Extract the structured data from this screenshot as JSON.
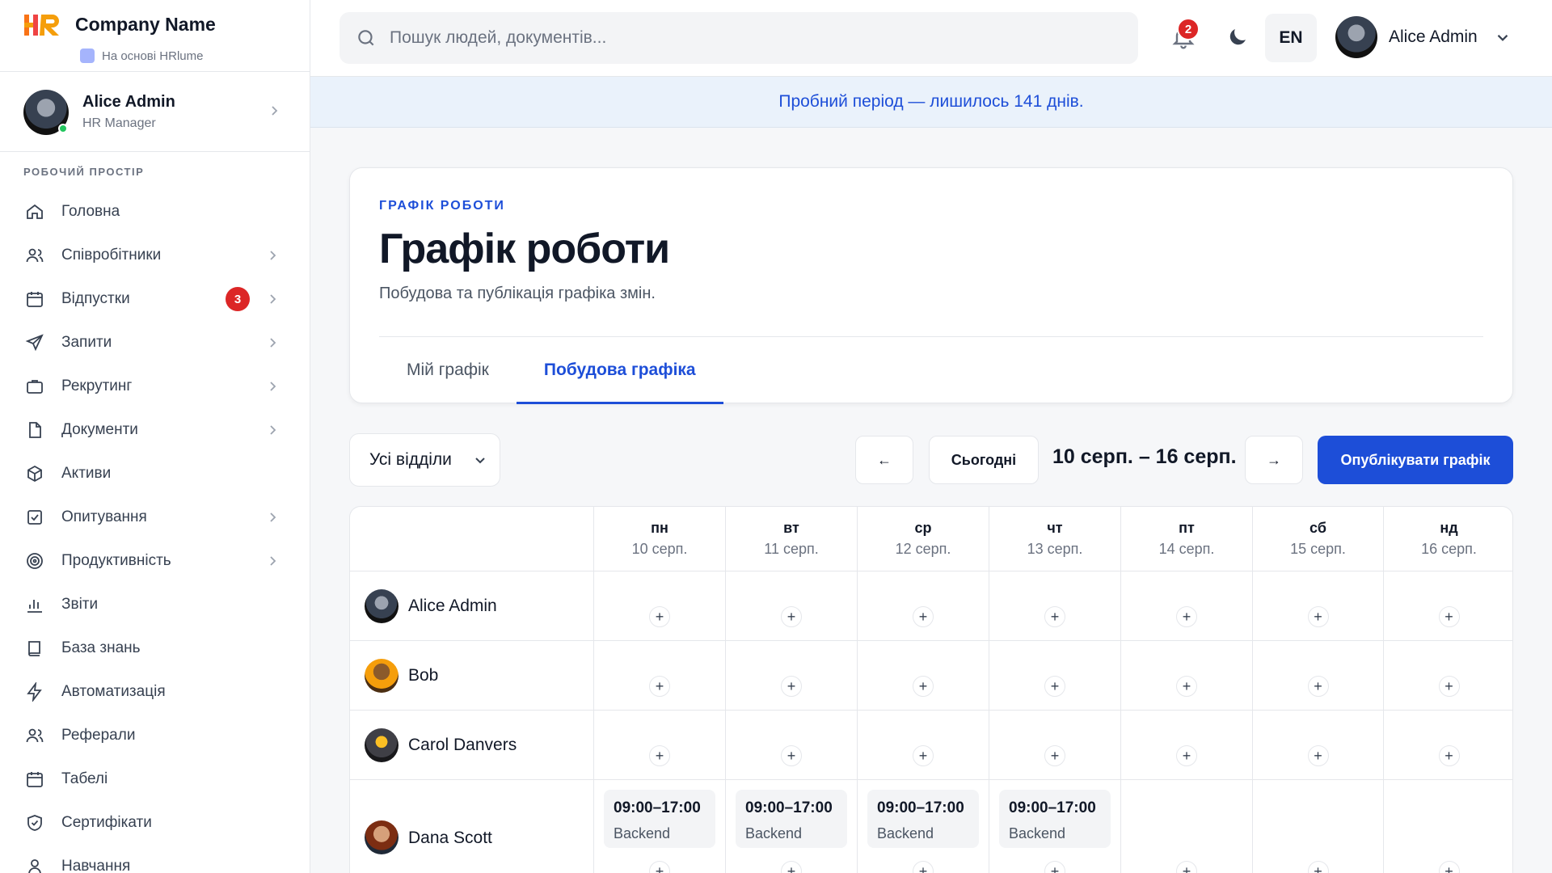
{
  "brand": {
    "name": "Company Name",
    "subtitle": "На основі HRlume"
  },
  "user_card": {
    "name": "Alice Admin",
    "role": "HR Manager"
  },
  "sidebar": {
    "section_label": "РОБОЧИЙ ПРОСТІР",
    "items": [
      {
        "label": "Головна",
        "icon": "home-icon"
      },
      {
        "label": "Співробітники",
        "icon": "users-icon"
      },
      {
        "label": "Відпустки",
        "icon": "calendar-icon",
        "badge": "3"
      },
      {
        "label": "Запити",
        "icon": "send-icon"
      },
      {
        "label": "Рекрутинг",
        "icon": "briefcase-icon"
      },
      {
        "label": "Документи",
        "icon": "document-icon"
      },
      {
        "label": "Активи",
        "icon": "box-icon"
      },
      {
        "label": "Опитування",
        "icon": "checkbox-icon"
      },
      {
        "label": "Продуктивність",
        "icon": "target-icon"
      },
      {
        "label": "Звіти",
        "icon": "bar-chart-icon"
      },
      {
        "label": "База знань",
        "icon": "book-icon"
      },
      {
        "label": "Автоматизація",
        "icon": "lightning-icon"
      },
      {
        "label": "Реферали",
        "icon": "users-icon"
      },
      {
        "label": "Табелі",
        "icon": "calendar-icon"
      },
      {
        "label": "Сертифікати",
        "icon": "shield-check-icon"
      },
      {
        "label": "Навчання",
        "icon": "user-icon"
      }
    ]
  },
  "topbar": {
    "search_placeholder": "Пошук людей, документів...",
    "notifications_count": "2",
    "language": "EN",
    "user_name": "Alice Admin"
  },
  "trial_banner": "Пробний період — лишилось 141 днів.",
  "page": {
    "eyebrow": "ГРАФІК РОБОТИ",
    "title": "Графік роботи",
    "subtitle": "Побудова та публікація графіка змін.",
    "tabs": [
      "Мій графік",
      "Побудова графіка"
    ],
    "active_tab": "Побудова графіка"
  },
  "toolbar": {
    "department": "Усі відділи",
    "prev": "←",
    "today": "Сьогодні",
    "week_range": "10 серп. – 16 серп.",
    "next": "→",
    "publish": "Опублікувати графік"
  },
  "schedule": {
    "days": [
      {
        "dow": "пн",
        "date": "10 серп."
      },
      {
        "dow": "вт",
        "date": "11 серп."
      },
      {
        "dow": "ср",
        "date": "12 серп."
      },
      {
        "dow": "чт",
        "date": "13 серп."
      },
      {
        "dow": "пт",
        "date": "14 серп."
      },
      {
        "dow": "сб",
        "date": "15 серп."
      },
      {
        "dow": "нд",
        "date": "16 серп."
      }
    ],
    "add_symbol": "+",
    "employees": [
      {
        "name": "Alice Admin",
        "shifts": [
          null,
          null,
          null,
          null,
          null,
          null,
          null
        ]
      },
      {
        "name": "Bob",
        "shifts": [
          null,
          null,
          null,
          null,
          null,
          null,
          null
        ]
      },
      {
        "name": "Carol Danvers",
        "shifts": [
          null,
          null,
          null,
          null,
          null,
          null,
          null
        ]
      },
      {
        "name": "Dana Scott",
        "shifts": [
          {
            "time": "09:00–17:00",
            "team": "Backend"
          },
          {
            "time": "09:00–17:00",
            "team": "Backend"
          },
          {
            "time": "09:00–17:00",
            "team": "Backend"
          },
          {
            "time": "09:00–17:00",
            "team": "Backend"
          },
          null,
          null,
          null
        ]
      }
    ]
  },
  "colors": {
    "accent": "#1d4ed8",
    "badge": "#dc2626",
    "banner_bg": "#eaf2fb"
  }
}
